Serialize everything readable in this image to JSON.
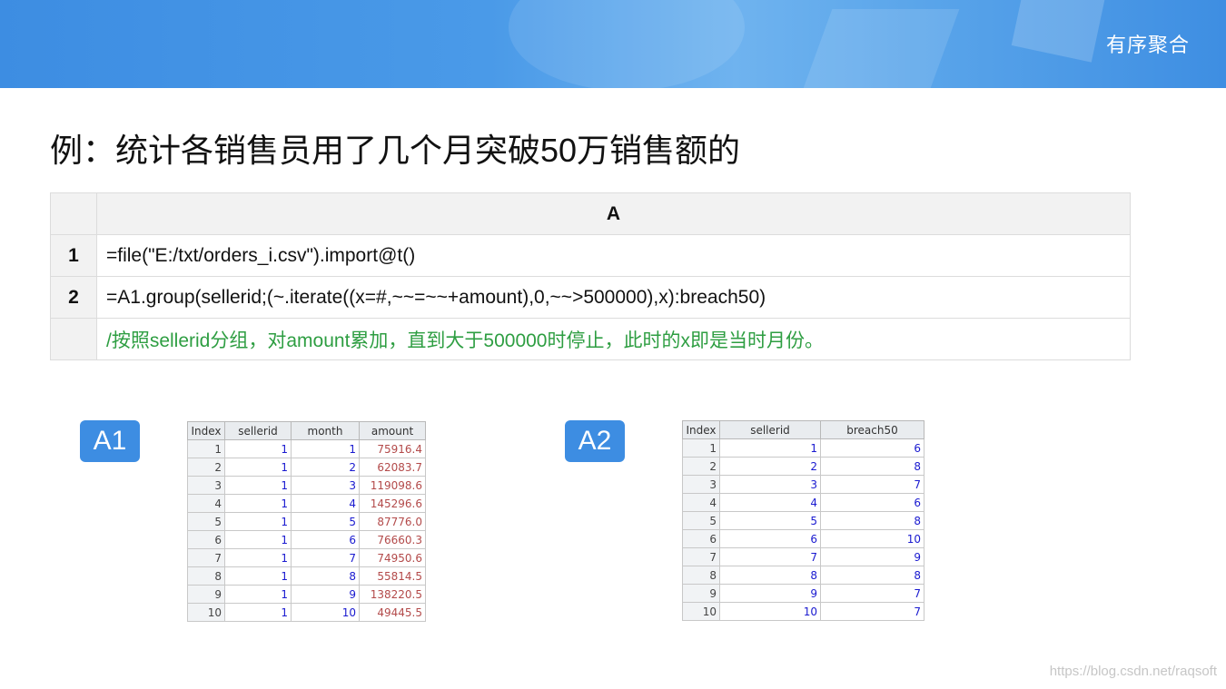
{
  "header": {
    "title": "有序聚合"
  },
  "slide": {
    "title": "例：统计各销售员用了几个月突破50万销售额的"
  },
  "code": {
    "column_header": "A",
    "rows": [
      {
        "num": "1",
        "text": "=file(\"E:/txt/orders_i.csv\").import@t()"
      },
      {
        "num": "2",
        "text": "=A1.group(sellerid;(~.iterate((x=#,~~=~~+amount),0,~~>500000),x):breach50)"
      },
      {
        "num": "",
        "text": "/按照sellerid分组，对amount累加，直到大于500000时停止，此时的x即是当时月份。"
      }
    ]
  },
  "a1": {
    "label": "A1",
    "headers": [
      "Index",
      "sellerid",
      "month",
      "amount"
    ],
    "rows": [
      [
        "1",
        "1",
        "1",
        "75916.4"
      ],
      [
        "2",
        "1",
        "2",
        "62083.7"
      ],
      [
        "3",
        "1",
        "3",
        "119098.6"
      ],
      [
        "4",
        "1",
        "4",
        "145296.6"
      ],
      [
        "5",
        "1",
        "5",
        "87776.0"
      ],
      [
        "6",
        "1",
        "6",
        "76660.3"
      ],
      [
        "7",
        "1",
        "7",
        "74950.6"
      ],
      [
        "8",
        "1",
        "8",
        "55814.5"
      ],
      [
        "9",
        "1",
        "9",
        "138220.5"
      ],
      [
        "10",
        "1",
        "10",
        "49445.5"
      ]
    ]
  },
  "a2": {
    "label": "A2",
    "headers": [
      "Index",
      "sellerid",
      "breach50"
    ],
    "rows": [
      [
        "1",
        "1",
        "6"
      ],
      [
        "2",
        "2",
        "8"
      ],
      [
        "3",
        "3",
        "7"
      ],
      [
        "4",
        "4",
        "6"
      ],
      [
        "5",
        "5",
        "8"
      ],
      [
        "6",
        "6",
        "10"
      ],
      [
        "7",
        "7",
        "9"
      ],
      [
        "8",
        "8",
        "8"
      ],
      [
        "9",
        "9",
        "7"
      ],
      [
        "10",
        "10",
        "7"
      ]
    ]
  },
  "watermark": "https://blog.csdn.net/raqsoft"
}
